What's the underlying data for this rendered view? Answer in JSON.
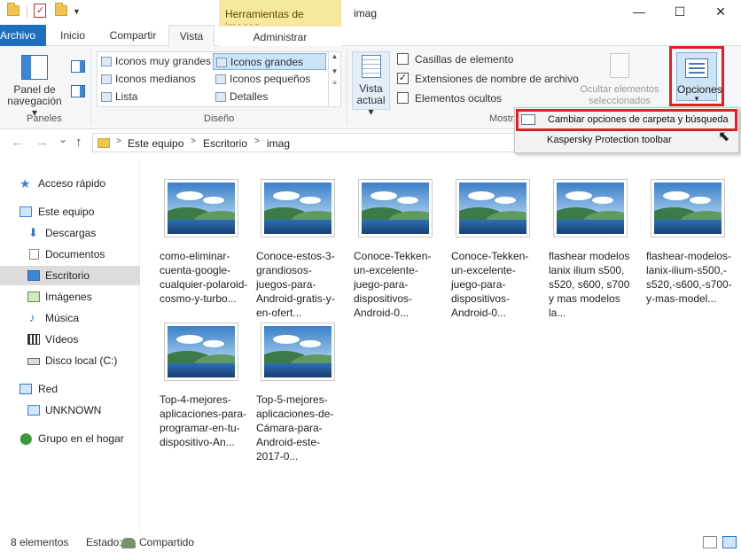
{
  "window": {
    "title": "imag",
    "context_tab": "Herramientas de imagen",
    "controls": {
      "minimize": "—",
      "maximize": "☐",
      "close": "✕"
    }
  },
  "tabs": [
    "Archivo",
    "Inicio",
    "Compartir",
    "Vista",
    "Administrar"
  ],
  "ribbon": {
    "panes": {
      "label": "Paneles",
      "nav_pane_line1": "Panel de",
      "nav_pane_line2": "navegación ▾"
    },
    "layout": {
      "label": "Diseño",
      "items": [
        "Iconos muy grandes",
        "Iconos grandes",
        "Iconos medianos",
        "Iconos pequeños",
        "Lista",
        "Detalles"
      ],
      "selected": "Iconos grandes"
    },
    "current_view": {
      "line1": "Vista",
      "line2": "actual ▾"
    },
    "show_hide": {
      "label": "Mostr",
      "checkboxes": [
        {
          "label": "Casillas de elemento",
          "checked": false
        },
        {
          "label": "Extensiones de nombre de archivo",
          "checked": true
        },
        {
          "label": "Elementos ocultos",
          "checked": false
        }
      ],
      "hide_selected_line1": "Ocultar elementos",
      "hide_selected_line2": "seleccionados"
    },
    "options": {
      "label": "Opciones",
      "arrow": "▾"
    }
  },
  "menu": {
    "items": [
      "Cambiar opciones de carpeta y búsqueda",
      "Kaspersky Protection toolbar"
    ]
  },
  "address": {
    "crumbs": [
      "Este equipo",
      "Escritorio",
      "imag"
    ],
    "back": "←",
    "forward": "→",
    "recent": "⌄",
    "up": "↑"
  },
  "nav_pane": {
    "items": [
      {
        "label": "Acceso rápido",
        "icon": "star-icon"
      },
      {
        "label": "Este equipo",
        "icon": "pc-icon"
      },
      {
        "label": "Descargas",
        "icon": "download-icon"
      },
      {
        "label": "Documentos",
        "icon": "document-icon"
      },
      {
        "label": "Escritorio",
        "icon": "desktop-icon"
      },
      {
        "label": "Imágenes",
        "icon": "pictures-icon"
      },
      {
        "label": "Música",
        "icon": "music-icon"
      },
      {
        "label": "Vídeos",
        "icon": "video-icon"
      },
      {
        "label": "Disco local (C:)",
        "icon": "disk-icon"
      },
      {
        "label": "Red",
        "icon": "network-icon"
      },
      {
        "label": "UNKNOWN",
        "icon": "computer-icon"
      },
      {
        "label": "Grupo en el hogar",
        "icon": "homegroup-icon"
      }
    ],
    "selected": "Escritorio"
  },
  "files": [
    {
      "name": "como-eliminar-cuenta-google-cualquier-polaroid-cosmo-y-turbo..."
    },
    {
      "name": "Conoce-estos-3-grandiosos-juegos-para-Android-gratis-y-en-ofert..."
    },
    {
      "name": "Conoce-Tekken-un-excelente-juego-para-dispositivos-Android-0..."
    },
    {
      "name": "Conoce-Tekken-un-excelente-juego-para-dispositivos-Android-0..."
    },
    {
      "name": "flashear modelos lanix ilium s500, s520, s600, s700 y mas modelos la..."
    },
    {
      "name": "flashear-modelos-lanix-ilium-s500,-s520,-s600,-s700-y-mas-model..."
    },
    {
      "name": "Top-4-mejores-aplicaciones-para-programar-en-tu-dispositivo-An..."
    },
    {
      "name": "Top-5-mejores-aplicaciones-de-Cámara-para-Android-este-2017-0..."
    }
  ],
  "status": {
    "count": "8 elementos",
    "state_label": "Estado:",
    "state_value": "Compartido"
  }
}
